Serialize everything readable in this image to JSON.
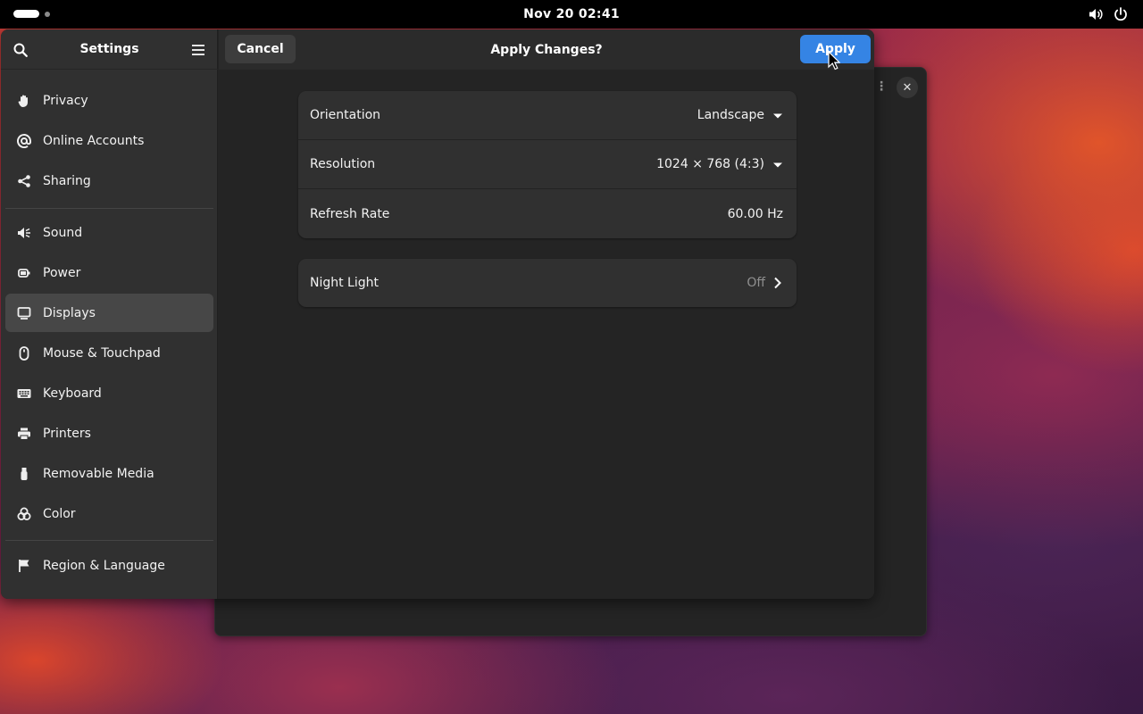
{
  "topbar": {
    "clock": "Nov 20  02:41",
    "icons": [
      "activities-indicator",
      "volume-icon",
      "power-icon"
    ]
  },
  "settings": {
    "title": "Settings",
    "header_icons": [
      "search-icon",
      "hamburger-menu-icon"
    ],
    "sidebar": {
      "items": [
        {
          "label": "Privacy",
          "icon": "hand-icon"
        },
        {
          "label": "Online Accounts",
          "icon": "at-icon"
        },
        {
          "label": "Sharing",
          "icon": "share-icon"
        },
        {
          "label": "Sound",
          "icon": "speaker-icon"
        },
        {
          "label": "Power",
          "icon": "battery-icon"
        },
        {
          "label": "Displays",
          "icon": "display-icon",
          "active": true
        },
        {
          "label": "Mouse & Touchpad",
          "icon": "mouse-icon"
        },
        {
          "label": "Keyboard",
          "icon": "keyboard-icon"
        },
        {
          "label": "Printers",
          "icon": "printer-icon"
        },
        {
          "label": "Removable Media",
          "icon": "usb-icon"
        },
        {
          "label": "Color",
          "icon": "color-icon"
        },
        {
          "label": "Region & Language",
          "icon": "flag-icon"
        }
      ]
    }
  },
  "dialog": {
    "title": "Apply Changes?",
    "cancel_label": "Cancel",
    "apply_label": "Apply",
    "display_card": {
      "rows": [
        {
          "label": "Orientation",
          "value": "Landscape",
          "control": "dropdown"
        },
        {
          "label": "Resolution",
          "value": "1024 × 768 (4:3)",
          "control": "dropdown"
        },
        {
          "label": "Refresh Rate",
          "value": "60.00 Hz",
          "control": "none"
        }
      ]
    },
    "night_light": {
      "label": "Night Light",
      "value": "Off"
    }
  },
  "colors": {
    "accent": "#3584e4",
    "window_bg": "#242424",
    "sidebar_bg": "#303030",
    "card_bg": "#303030",
    "active_item_bg": "#474747",
    "topbar_bg": "#000000"
  }
}
